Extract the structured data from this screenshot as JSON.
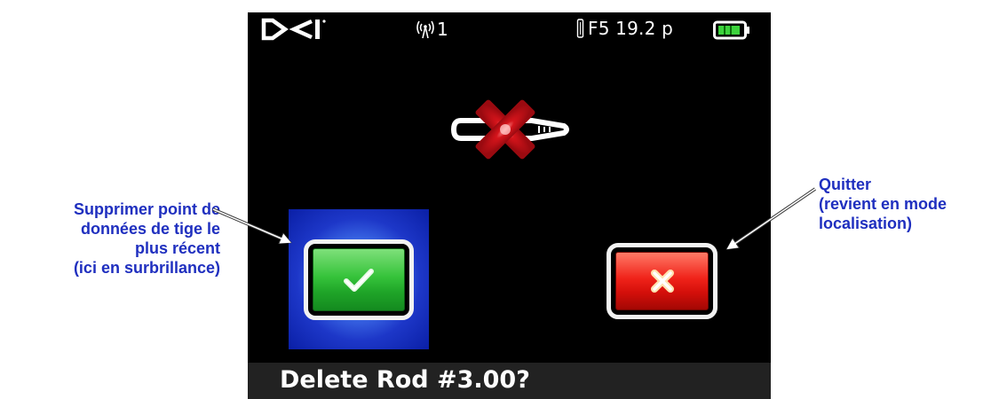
{
  "status_bar": {
    "logo_icon": "dci-logo",
    "signal_icon": "antenna-signal-icon",
    "channel": "1",
    "readout": "F5 19.2 p",
    "battery_icon": "battery-icon",
    "battery_level_fraction": 1.0
  },
  "screen": {
    "probe_graphic_icon": "transmitter-delete-icon",
    "confirm_button_icon": "checkmark-icon",
    "cancel_button_icon": "x-icon",
    "prompt": "Delete Rod #3.00?"
  },
  "callouts": {
    "left": {
      "lines": [
        "Supprimer point de",
        "données de tige le",
        "plus récent",
        "(ici en surbrillance)"
      ]
    },
    "right": {
      "lines": [
        "Quitter",
        "(revient en mode",
        "localisation)"
      ]
    }
  },
  "colors": {
    "callout_text": "#1f2fbf",
    "screen_background": "#000000",
    "confirm_green": "#36c33b",
    "cancel_red": "#f0231a",
    "highlight_blue": "#1d37c8",
    "prompt_bar": "#222222"
  }
}
